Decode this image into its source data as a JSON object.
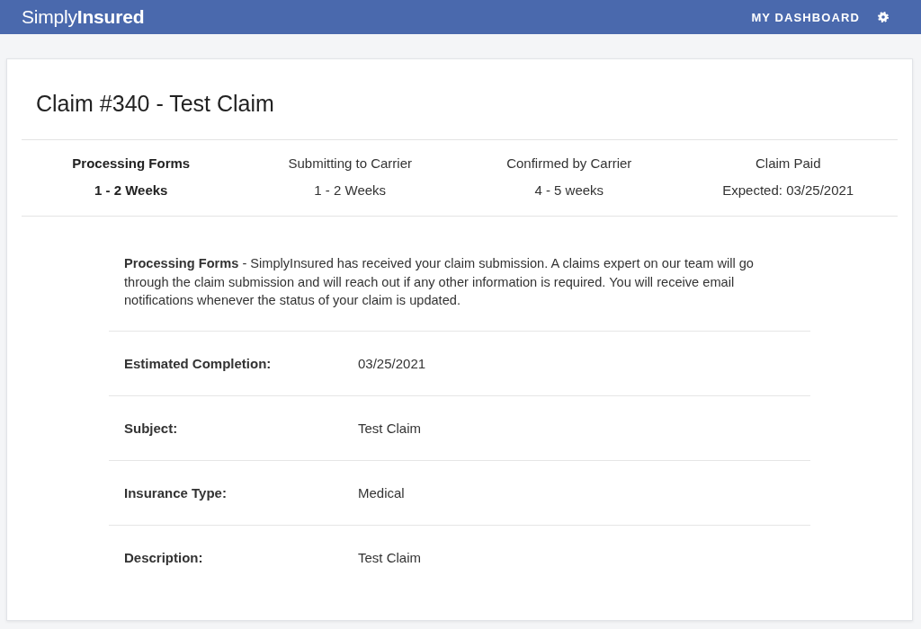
{
  "navbar": {
    "logo": "Simply**Insured**",
    "links": [
      {
        "label": "MY DASHBOARD"
      }
    ]
  },
  "claim": {
    "title": "Claim #340 - Test Claim",
    "steps": [
      {
        "label": "Processing Forms",
        "duration": "1 - 2 Weeks",
        "current": true
      },
      {
        "label": "Submitting to Carrier",
        "duration": "1 - 2 Weeks",
        "current": false
      },
      {
        "label": "Confirmed by Carrier",
        "duration": "4 - 5 weeks",
        "current": false
      },
      {
        "label": "Claim Paid",
        "duration": "Expected: 03/25/2021",
        "current": false
      }
    ],
    "status_description": "**Processing Forms** - SimplyInsured has received your claim submission. A claims expert on our team will go through the claim submission and will reach out if any other information is required. You will receive email notifications whenever the status of your claim is updated.",
    "details": [
      {
        "label": "Estimated Completion:",
        "value": "03/25/2021"
      },
      {
        "label": "Subject:",
        "value": "Test Claim"
      },
      {
        "label": "Insurance Type:",
        "value": "Medical"
      },
      {
        "label": "Description:",
        "value": "Test Claim"
      }
    ]
  }
}
